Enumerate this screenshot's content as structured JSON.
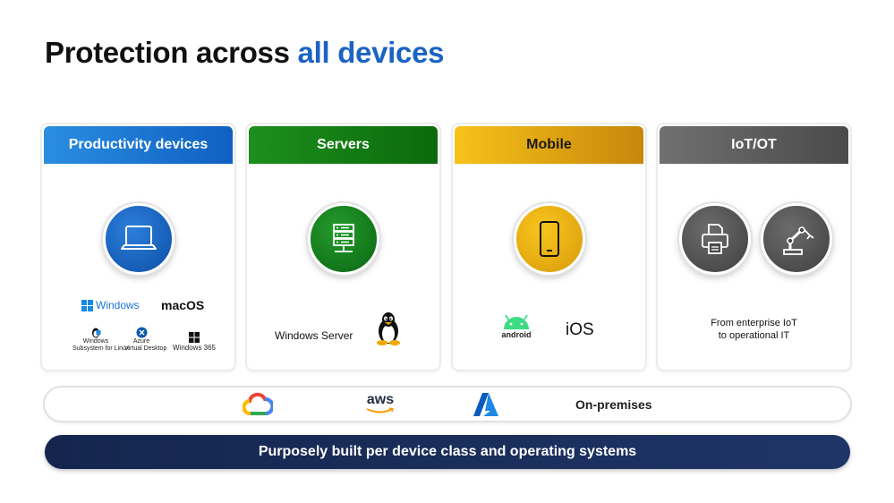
{
  "slide": {
    "title_prefix": "Protection across ",
    "title_accent": "all devices",
    "accent_color": "#1a63c4"
  },
  "cards": [
    {
      "header": "Productivity devices",
      "color": "#1a73d6",
      "icon": "laptop-icon",
      "logos": {
        "windows": "Windows",
        "macos": "macOS",
        "wsl": "Windows\nSubsystem for Linux",
        "avd": "Azure\nVirtual Desktop",
        "w365": "Windows 365"
      }
    },
    {
      "header": "Servers",
      "color": "#128412",
      "icon": "server-icon",
      "logos": {
        "windows_server": "Windows Server",
        "linux": "linux-tux-icon"
      }
    },
    {
      "header": "Mobile",
      "color": "#e3a712",
      "icon": "smartphone-icon",
      "logos": {
        "android": "android",
        "ios": "iOS"
      }
    },
    {
      "header": "IoT/OT",
      "color": "#5c5c5c",
      "icons": [
        "printer-icon",
        "robotic-arm-icon"
      ],
      "caption": "From enterprise IoT\nto operational IT"
    }
  ],
  "environments": {
    "items": [
      "google-cloud-icon",
      "aws-icon",
      "azure-icon"
    ],
    "aws_label": "aws",
    "on_premises": "On-premises"
  },
  "tagline": "Purposely built per device class and operating systems"
}
